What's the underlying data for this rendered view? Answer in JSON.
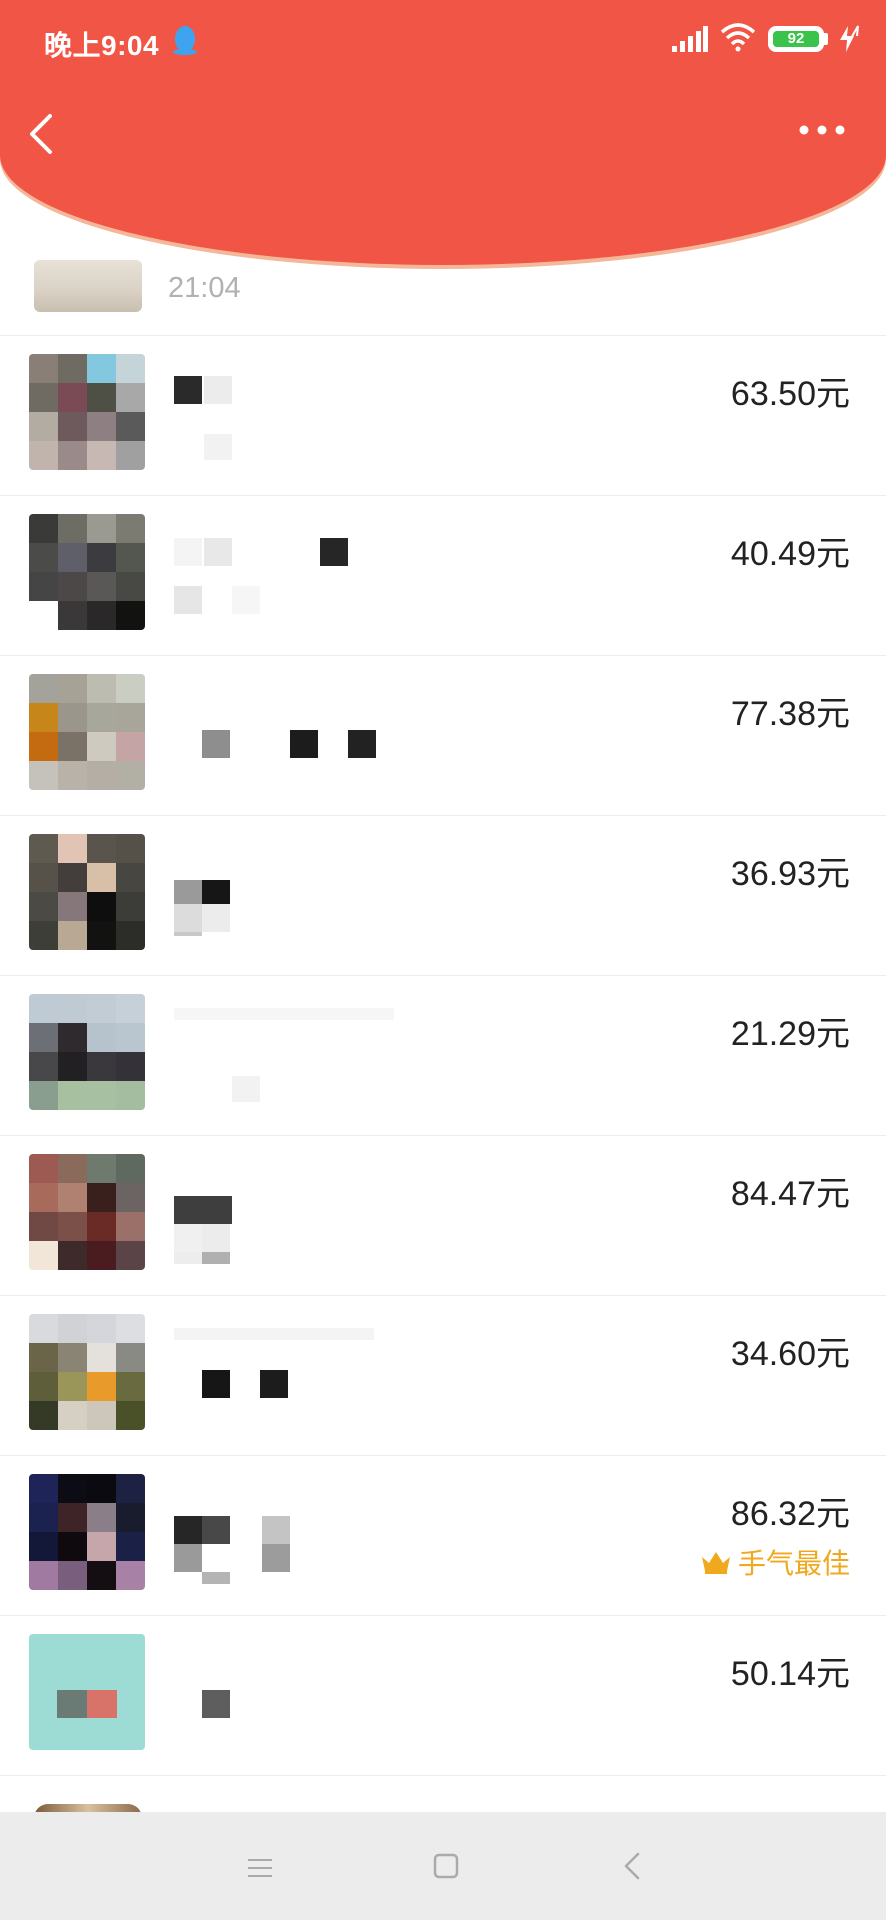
{
  "status_bar": {
    "time": "晚上9:04",
    "battery": "92"
  },
  "list": {
    "peek_time": "21:04",
    "rows": [
      {
        "amount": "63.50元"
      },
      {
        "amount": "40.49元"
      },
      {
        "amount": "77.38元"
      },
      {
        "amount": "36.93元"
      },
      {
        "amount": "21.29元"
      },
      {
        "amount": "84.47元"
      },
      {
        "amount": "34.60元"
      },
      {
        "amount": "86.32元",
        "badge": "手气最佳"
      },
      {
        "amount": "50.14元"
      }
    ]
  },
  "colors": {
    "header": "#f15545",
    "best_luck": "#f0a81e",
    "navbar": "#ececec"
  },
  "icons": [
    "back-arrow-icon",
    "more-dots-icon",
    "qq-penguin-icon",
    "signal-icon",
    "wifi-icon",
    "battery-icon",
    "charging-icon",
    "crown-icon",
    "menu-lines-icon",
    "home-square-icon",
    "back-chevron-icon"
  ]
}
